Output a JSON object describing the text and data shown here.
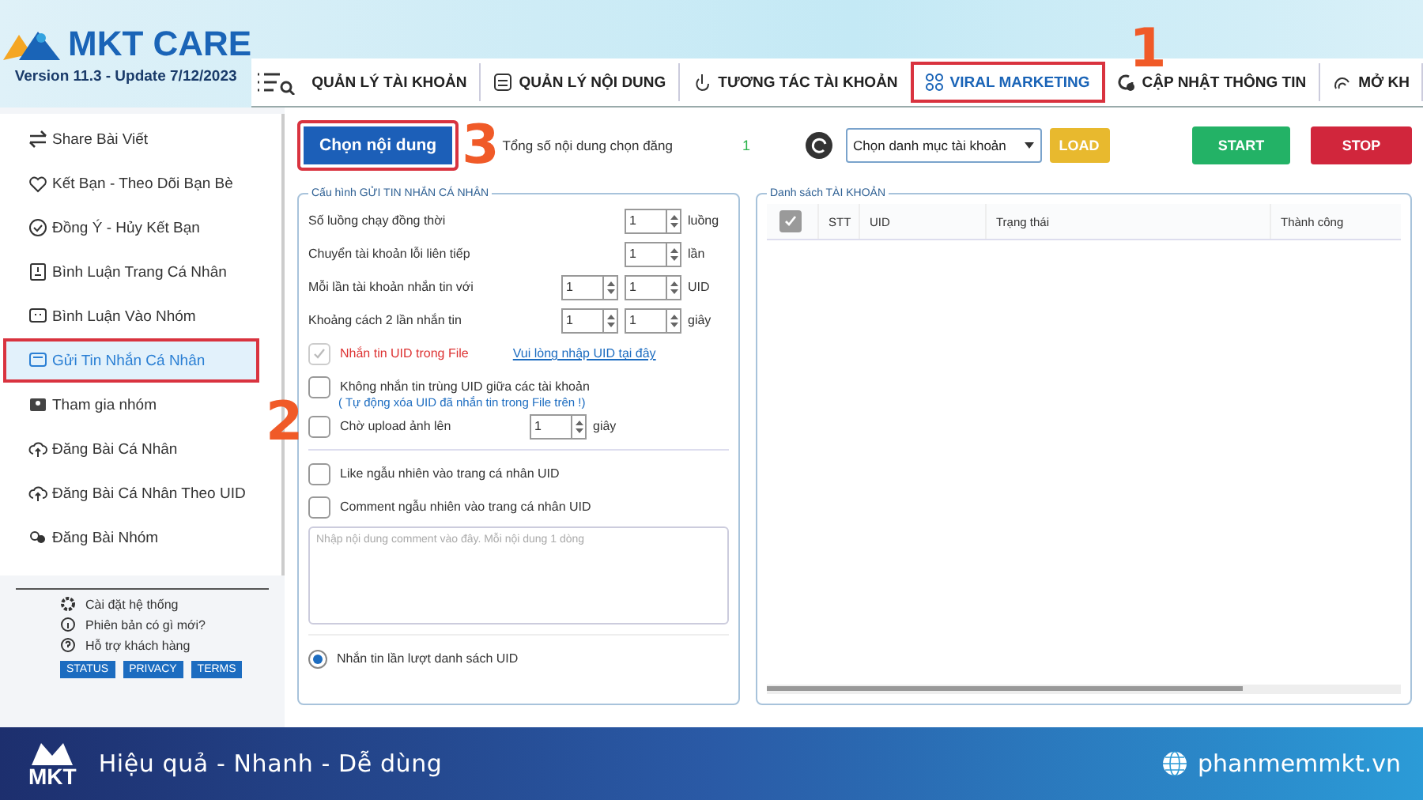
{
  "logo": {
    "title": "MKT CARE",
    "version": "Version  11.3 - Update  7/12/2023"
  },
  "tabs": [
    {
      "label": "QUẢN LÝ TÀI KHOẢN",
      "selected": false,
      "highlighted": false
    },
    {
      "label": "QUẢN LÝ NỘI DUNG",
      "selected": false,
      "highlighted": false
    },
    {
      "label": "TƯƠNG TÁC TÀI KHOẢN",
      "selected": false,
      "highlighted": false
    },
    {
      "label": "VIRAL MARKETING",
      "selected": true,
      "highlighted": true
    },
    {
      "label": "CẬP NHẬT THÔNG TIN",
      "selected": false,
      "highlighted": false
    },
    {
      "label": "MỞ KH",
      "selected": false,
      "highlighted": false
    }
  ],
  "annotations": [
    {
      "text": "1"
    },
    {
      "text": "2"
    },
    {
      "text": "3"
    }
  ],
  "sidebar": {
    "items": [
      {
        "label": "Share Bài Viết",
        "selected": false,
        "highlighted": false
      },
      {
        "label": "Kết Bạn - Theo Dõi Bạn Bè",
        "selected": false,
        "highlighted": false
      },
      {
        "label": "Đồng Ý - Hủy Kết Bạn",
        "selected": false,
        "highlighted": false
      },
      {
        "label": "Bình Luận Trang Cá Nhân",
        "selected": false,
        "highlighted": false
      },
      {
        "label": "Bình Luận Vào Nhóm",
        "selected": false,
        "highlighted": false
      },
      {
        "label": "Gửi Tin Nhắn Cá Nhân",
        "selected": true,
        "highlighted": true
      },
      {
        "label": "Tham gia nhóm",
        "selected": false,
        "highlighted": false
      },
      {
        "label": "Đăng Bài Cá Nhân",
        "selected": false,
        "highlighted": false
      },
      {
        "label": "Đăng Bài Cá Nhân Theo UID",
        "selected": false,
        "highlighted": false
      },
      {
        "label": "Đăng Bài Nhóm",
        "selected": false,
        "highlighted": false
      }
    ],
    "links": [
      "Cài đặt hệ thống",
      "Phiên bản có gì mới?",
      "Hỗ trợ khách hàng"
    ],
    "badges": [
      "STATUS",
      "PRIVACY",
      "TERMS"
    ]
  },
  "toolbar": {
    "choose_button": {
      "label": "Chọn nội dung",
      "highlighted": true
    },
    "total_label": "Tổng số nội dung chọn đăng",
    "total_count": "1",
    "category": {
      "value": "Chọn danh mục tài khoản"
    },
    "load": "LOAD",
    "start": "START",
    "stop": "STOP"
  },
  "config": {
    "title": "Cấu hình GỬI TIN NHẮN CÁ NHÂN",
    "rows": [
      {
        "kind": "spin1",
        "label": "Số luồng chạy đồng thời",
        "values": [
          "1"
        ],
        "unit": "luồng"
      },
      {
        "kind": "spin1",
        "label": "Chuyển tài khoản lỗi liên tiếp",
        "values": [
          "1"
        ],
        "unit": "lần"
      },
      {
        "kind": "spin2",
        "label": "Mỗi lần tài khoản nhắn tin với",
        "values": [
          "1",
          "1"
        ],
        "unit": "UID"
      },
      {
        "kind": "spin2",
        "label": "Khoảng cách 2 lần nhắn tin",
        "values": [
          "1",
          "1"
        ],
        "unit": "giây"
      },
      {
        "kind": "check",
        "label": "Nhắn tin UID trong File",
        "checked": true,
        "link": "Vui lòng nhập  UID tại đây"
      },
      {
        "kind": "check",
        "label": "Không nhắn tin trùng UID giữa các tài khoản",
        "checked": false,
        "note": "( Tự động xóa UID đã nhắn tin trong File trên !)"
      },
      {
        "kind": "check",
        "label": "Chờ upload ảnh lên",
        "checked": false,
        "values": [
          "1"
        ],
        "unit": "giây"
      },
      {
        "kind": "divider"
      },
      {
        "kind": "check",
        "label": "Like ngẫu nhiên vào trang cá nhân UID",
        "checked": false
      },
      {
        "kind": "check",
        "label": "Comment ngẫu nhiên vào trang cá nhân UID",
        "checked": false
      },
      {
        "kind": "textarea",
        "placeholder": "Nhập nội dung comment vào đây. Mỗi nội dung 1 dòng"
      },
      {
        "kind": "radio",
        "label": "Nhắn tin lần lượt danh sách UID",
        "selected": true
      }
    ]
  },
  "accounts": {
    "title": "Danh sách TÀI KHOẢN",
    "select_all": true,
    "columns": [
      "STT",
      "UID",
      "Trạng thái",
      "Thành công"
    ]
  },
  "footer": {
    "slogan": "Hiệu quả - Nhanh  - Dễ dùng",
    "brand": "MKT",
    "website": "phanmemmkt.vn"
  }
}
